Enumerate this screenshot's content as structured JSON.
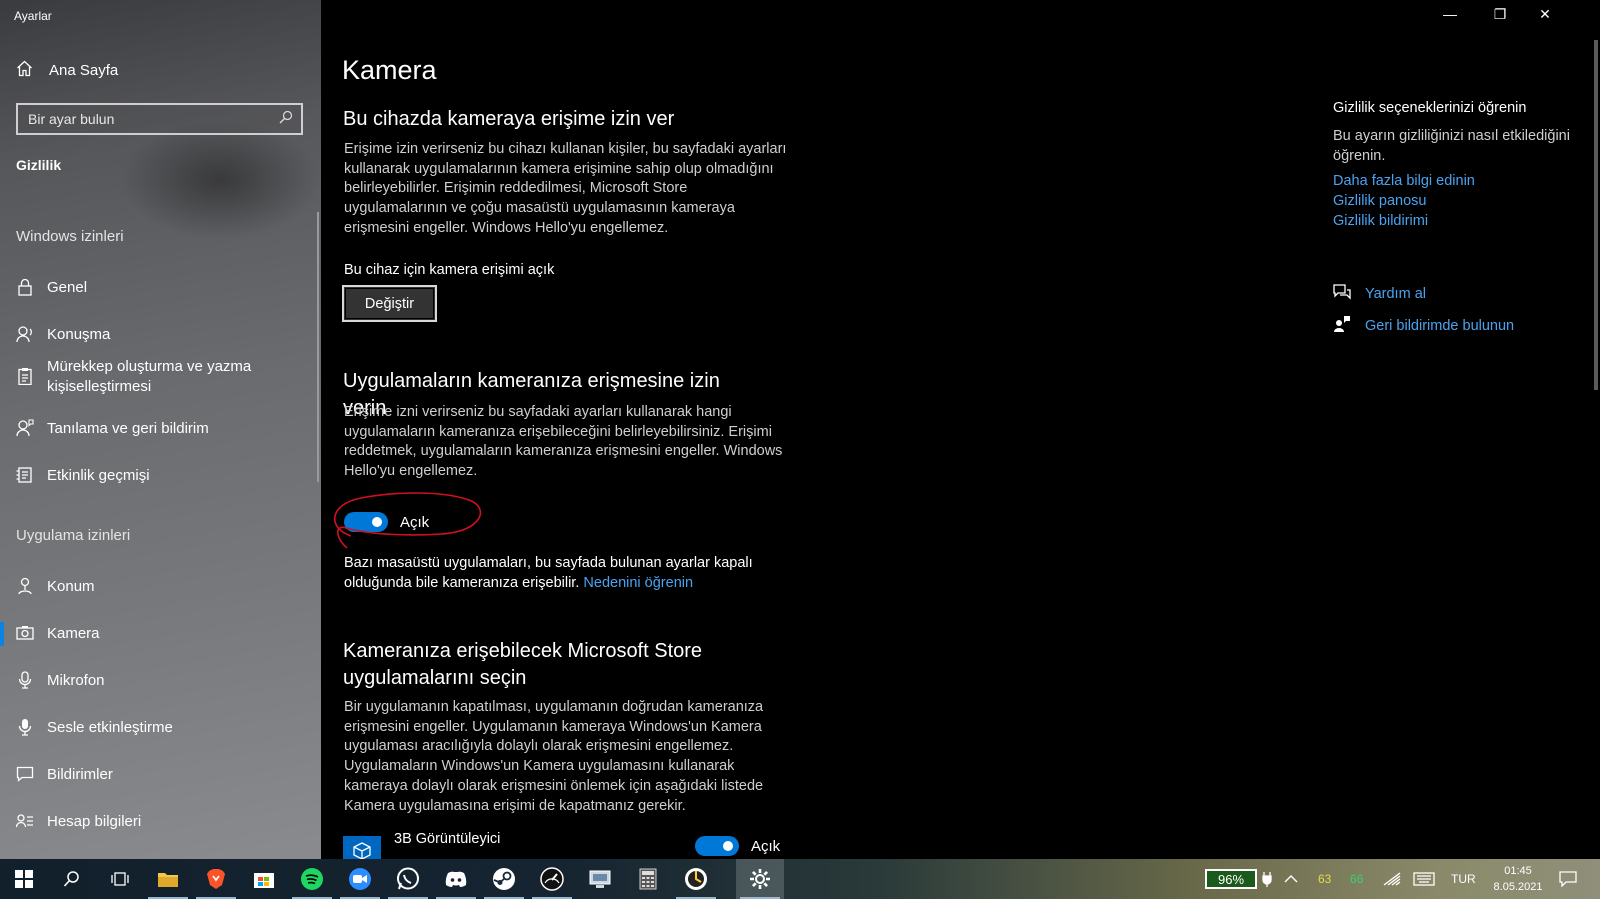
{
  "window": {
    "app_title": "Ayarlar",
    "minimize_glyph": "—",
    "restore_glyph": "❐",
    "close_glyph": "✕"
  },
  "sidebar": {
    "home_label": "Ana Sayfa",
    "search_placeholder": "Bir ayar bulun",
    "section_title": "Gizlilik",
    "group_windows": "Windows izinleri",
    "windows_items": [
      {
        "label": "Genel",
        "icon": "lock-icon"
      },
      {
        "label": "Konuşma",
        "icon": "speech-icon"
      },
      {
        "label": "Mürekkep oluşturma ve yazma kişiselleştirmesi",
        "icon": "clipboard-icon"
      },
      {
        "label": "Tanılama ve geri bildirim",
        "icon": "person-feedback-icon"
      },
      {
        "label": "Etkinlik geçmişi",
        "icon": "history-icon"
      }
    ],
    "group_apps": "Uygulama izinleri",
    "app_items": [
      {
        "label": "Konum",
        "icon": "location-icon"
      },
      {
        "label": "Kamera",
        "icon": "camera-icon",
        "active": true
      },
      {
        "label": "Mikrofon",
        "icon": "microphone-icon"
      },
      {
        "label": "Sesle etkinleştirme",
        "icon": "voice-icon"
      },
      {
        "label": "Bildirimler",
        "icon": "notification-icon"
      },
      {
        "label": "Hesap bilgileri",
        "icon": "account-info-icon"
      }
    ]
  },
  "main": {
    "page_title": "Kamera",
    "section1": {
      "heading": "Bu cihazda kameraya erişime izin ver",
      "description": "Erişime izin verirseniz bu cihazı kullanan kişiler, bu sayfadaki ayarları kullanarak uygulamalarının kamera erişimine sahip olup olmadığını belirleyebilirler. Erişimin reddedilmesi, Microsoft Store uygulamalarının ve çoğu masaüstü uygulamasının kameraya erişmesini engeller. Windows Hello'yu engellemez.",
      "status": "Bu cihaz için kamera erişimi açık",
      "change_button": "Değiştir"
    },
    "section2": {
      "heading": "Uygulamaların kameranıza erişmesine izin verin",
      "description": "Erişime izni verirseniz bu sayfadaki ayarları kullanarak hangi uygulamaların kameranıza erişebileceğini belirleyebilirsiniz. Erişimi reddetmek, uygulamaların kameranıza erişmesini engeller. Windows Hello'yu engellemez.",
      "toggle_state": "Açık",
      "toggle_on": true,
      "note": "Bazı masaüstü uygulamaları, bu sayfada bulunan ayarlar kapalı olduğunda bile kameranıza erişebilir.",
      "note_link": "Nedenini öğrenin"
    },
    "section3": {
      "heading": "Kameranıza erişebilecek Microsoft Store uygulamalarını seçin",
      "description": "Bir uygulamanın kapatılması, uygulamanın doğrudan kameranıza erişmesini engeller. Uygulamanın kameraya Windows'un Kamera uygulaması aracılığıyla dolaylı olarak erişmesini engellemez. Uygulamaların Windows'un Kamera uygulamasını kullanarak kameraya dolaylı olarak erişmesini önlemek için aşağıdaki listede Kamera uygulamasına erişimi de kapatmanız gerekir.",
      "apps": [
        {
          "name": "3B Görüntüleyici",
          "state": "Açık",
          "on": true
        }
      ]
    },
    "right": {
      "title": "Gizlilik seçeneklerinizi öğrenin",
      "text": "Bu ayarın gizliliğinizi nasıl etkilediğini öğrenin.",
      "links": [
        "Daha fazla bilgi edinin",
        "Gizlilik panosu",
        "Gizlilik bildirimi"
      ],
      "help": "Yardım al",
      "feedback": "Geri bildirimde bulunun"
    }
  },
  "taskbar": {
    "apps": [
      "start-icon",
      "search-icon",
      "task-view-icon",
      "file-explorer-icon",
      "brave-icon",
      "store-icon",
      "spotify-icon",
      "zoom-icon",
      "whatsapp-icon",
      "discord-icon",
      "steam-icon",
      "gauge-icon",
      "monitor-app-icon",
      "calculator-icon",
      "yandex-icon",
      "settings-icon"
    ],
    "battery": "96%",
    "temp1": "63",
    "temp2": "66",
    "language": "TUR",
    "time": "01:45",
    "date": "8.05.2021"
  },
  "colors": {
    "accent": "#0078d7",
    "link": "#4aa3f0",
    "annotation": "#d01020"
  }
}
